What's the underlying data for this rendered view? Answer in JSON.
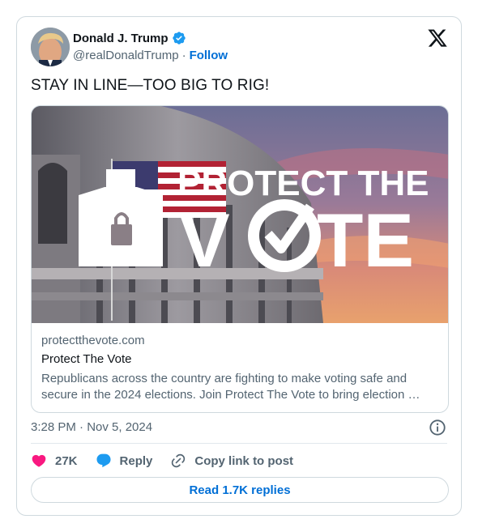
{
  "author": {
    "name": "Donald J. Trump",
    "handle": "@realDonaldTrump",
    "separator": "·",
    "follow_label": "Follow"
  },
  "tweet": {
    "text": "STAY IN LINE—TOO BIG TO RIG!",
    "timestamp": "3:28 PM · Nov 5, 2024"
  },
  "link_card": {
    "image_headline_line1": "PROTECT THE",
    "image_headline_line2": "V",
    "image_headline_line2_end": "TE",
    "domain": "protectthevote.com",
    "title": "Protect The Vote",
    "description": "Republicans across the country are fighting to make voting safe and secure in the 2024 elections. Join Protect The Vote to bring election …"
  },
  "actions": {
    "likes": "27K",
    "reply_label": "Reply",
    "copy_label": "Copy link to post"
  },
  "read_replies_label": "Read 1.7K replies",
  "colors": {
    "accent": "#006fd6",
    "like": "#f91880",
    "reply": "#1d9bf0",
    "verified": "#1d9bf0"
  }
}
